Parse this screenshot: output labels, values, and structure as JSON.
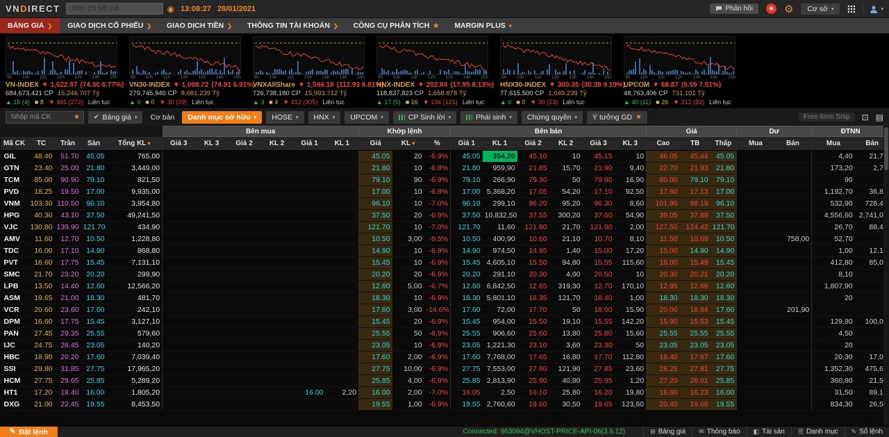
{
  "topbar": {
    "logo_vn": "VN",
    "logo_d": "D",
    "logo_rest": "IRECT",
    "search_placeholder": "Xem chi tiết mã",
    "time": "13:08:27",
    "date": "28/01/2021",
    "feedback": "Phản hồi",
    "market": "Cơ sở"
  },
  "menu": {
    "items": [
      {
        "label": "BẢNG GIÁ",
        "suffix": "arrow",
        "active": true
      },
      {
        "label": "GIAO DỊCH CỔ PHIẾU",
        "suffix": "arrow",
        "active": false
      },
      {
        "label": "GIAO DỊCH TIỀN",
        "suffix": "arrow",
        "active": false
      },
      {
        "label": "THÔNG TIN TÀI KHOÁN",
        "suffix": "arrow",
        "active": false
      },
      {
        "label": "CÔNG CỤ PHÂN TÍCH",
        "suffix": "star",
        "active": false
      },
      {
        "label": "MARGIN PLUS",
        "suffix": "caret",
        "active": false
      }
    ]
  },
  "indices": [
    {
      "name": "VN-INDEX",
      "direction": "down",
      "value": "1,022.87",
      "change": "(74.30 6.77%)",
      "volume": "684,673,421 CP",
      "turnover": "15,246.707 Tỷ",
      "up": "15 (4)",
      "flat": "8",
      "down": "481 (272)",
      "session": "Liên tục"
    },
    {
      "name": "VN30-INDEX",
      "direction": "down",
      "value": "1,008.72",
      "change": "(74.91 6.91%)",
      "volume": "279,745,940 CP",
      "turnover": "8,681.239 Tỷ",
      "up": "0",
      "flat": "0",
      "down": "30 (29)",
      "session": "Liên tục"
    },
    {
      "name": "VNXAllShare",
      "direction": "down",
      "value": "1,546.18",
      "change": "(112.93 6.81%)",
      "volume": "726,738,180 CP",
      "turnover": "15,993.712 Tỷ",
      "up": "3",
      "flat": "4",
      "down": "412 (305)",
      "session": "Liên tục"
    },
    {
      "name": "HNX-INDEX",
      "direction": "down",
      "value": "202.84",
      "change": "(17.95 8.13%)",
      "volume": "118,837,823 CP",
      "turnover": "1,658.878 Tỷ",
      "up": "17 (5)",
      "flat": "16",
      "down": "194 (121)",
      "session": "Liên tục"
    },
    {
      "name": "HNX30-INDEX",
      "direction": "down",
      "value": "300.35",
      "change": "(30.38 9.19%)",
      "volume": "77,615,500 CP",
      "turnover": "1,049.239 Tỷ",
      "up": "0",
      "flat": "0",
      "down": "30 (23)",
      "session": "Liên tục"
    },
    {
      "name": "UPCOM",
      "direction": "down",
      "value": "68.87",
      "change": "(5.59 7.51%)",
      "volume": "48,763,406 CP",
      "turnover": "731.101 Tỷ",
      "up": "40 (11)",
      "flat": "26",
      "down": "212 (82)",
      "session": "Liên tục"
    }
  ],
  "chart_axis": [
    "9h",
    "10h",
    "11h",
    "12h",
    "13h",
    "14h",
    "15h"
  ],
  "filterbar": {
    "symbol_placeholder": "Nhập mã CK",
    "board_select": "Bảng giá",
    "view_label": "Cơ bản",
    "active_tab": "Danh mục sở hữu",
    "tabs": [
      "HOSE",
      "HNX",
      "UPCOM",
      "CP Sinh lời",
      "Phái sinh",
      "Chứng quyền",
      "Ý tưởng GD"
    ],
    "ghost_text": "Free-form Snip"
  },
  "table": {
    "groups": {
      "buy": "Bên mua",
      "match": "Khớp lệnh",
      "sell": "Bên bán",
      "price": "Giá",
      "du": "Dư",
      "foreign": "ĐTNN"
    },
    "columns": [
      "Mã CK",
      "TC",
      "Trần",
      "Sàn",
      "Tổng KL",
      "Giá 3",
      "KL 3",
      "Giá 2",
      "KL 2",
      "Giá 1",
      "KL 1",
      "Giá",
      "KL",
      "%",
      "Giá 1",
      "KL 1",
      "Giá 2",
      "KL 2",
      "Giá 3",
      "KL 3",
      "Cao",
      "TB",
      "Thấp",
      "Mua",
      "Bán",
      "Mua",
      "Bán"
    ],
    "rows": [
      {
        "code": "GIL",
        "tc": "48.40",
        "ceil": "51.70",
        "floor": "45.05",
        "total": "765,00",
        "buy": [
          "",
          "",
          "",
          "",
          "",
          ""
        ],
        "match": [
          "45.05",
          "20",
          "-6.9%"
        ],
        "sell": [
          "45.05",
          "354,20",
          "45.10",
          "10",
          "45.15",
          "10"
        ],
        "hi": "46.05",
        "avg": "45.44",
        "lo": "45.05",
        "du": [
          "",
          ""
        ],
        "fr": [
          "4,40",
          "21,70"
        ],
        "flash": "sk1"
      },
      {
        "code": "GTN",
        "tc": "23.40",
        "ceil": "25.00",
        "floor": "21.80",
        "total": "3,449,00",
        "buy": [
          "",
          "",
          "",
          "",
          "",
          ""
        ],
        "match": [
          "21.80",
          "10",
          "-6.8%"
        ],
        "sell": [
          "21.80",
          "959,90",
          "21.85",
          "15,70",
          "21.90",
          "9,40"
        ],
        "hi": "22.70",
        "avg": "21.93",
        "lo": "21.80",
        "du": [
          "",
          ""
        ],
        "fr": [
          "173,20",
          "2,70"
        ],
        "flash": ""
      },
      {
        "code": "TCM",
        "tc": "85.00",
        "ceil": "90.90",
        "floor": "79.10",
        "total": "821,50",
        "buy": [
          "",
          "",
          "",
          "",
          "",
          ""
        ],
        "match": [
          "79.10",
          "90",
          "-6.9%"
        ],
        "sell": [
          "79.10",
          "266,90",
          "79.30",
          "50",
          "79.90",
          "16,90"
        ],
        "hi": "80.00",
        "avg": "79.10",
        "lo": "79.10",
        "du": [
          "",
          ""
        ],
        "fr": [
          "90",
          ""
        ],
        "flash": ""
      },
      {
        "code": "PVD",
        "tc": "18.25",
        "ceil": "19.50",
        "floor": "17.00",
        "total": "9,935,00",
        "buy": [
          "",
          "",
          "",
          "",
          "",
          ""
        ],
        "match": [
          "17.00",
          "10",
          "-6.8%"
        ],
        "sell": [
          "17.00",
          "5,368,20",
          "17.05",
          "54,20",
          "17.10",
          "92,50"
        ],
        "hi": "17.60",
        "avg": "17.13",
        "lo": "17.00",
        "du": [
          "",
          ""
        ],
        "fr": [
          "1,192,70",
          "36,80"
        ],
        "flash": ""
      },
      {
        "code": "VNM",
        "tc": "103.30",
        "ceil": "110.50",
        "floor": "96.10",
        "total": "3,954,80",
        "buy": [
          "",
          "",
          "",
          "",
          "",
          ""
        ],
        "match": [
          "96.10",
          "10",
          "-7.0%"
        ],
        "sell": [
          "96.10",
          "299,10",
          "96.20",
          "95,20",
          "96.30",
          "8,60"
        ],
        "hi": "101.90",
        "avg": "98.19",
        "lo": "96.10",
        "du": [
          "",
          ""
        ],
        "fr": [
          "532,90",
          "728,40"
        ],
        "flash": ""
      },
      {
        "code": "HPG",
        "tc": "40.30",
        "ceil": "43.10",
        "floor": "37.50",
        "total": "49,241,50",
        "buy": [
          "",
          "",
          "",
          "",
          "",
          ""
        ],
        "match": [
          "37.50",
          "20",
          "-6.9%"
        ],
        "sell": [
          "37.50",
          "10,832,50",
          "37.55",
          "300,20",
          "37.60",
          "54,90"
        ],
        "hi": "39.05",
        "avg": "37.89",
        "lo": "37.50",
        "du": [
          "",
          ""
        ],
        "fr": [
          "4,556,60",
          "2,741,00"
        ],
        "flash": ""
      },
      {
        "code": "VJC",
        "tc": "130.80",
        "ceil": "139.90",
        "floor": "121.70",
        "total": "434,90",
        "buy": [
          "",
          "",
          "",
          "",
          "",
          ""
        ],
        "match": [
          "121.70",
          "10",
          "-7.0%"
        ],
        "sell": [
          "121.70",
          "11,60",
          "121.80",
          "21,70",
          "121.90",
          "2,00"
        ],
        "hi": "127.50",
        "avg": "124.42",
        "lo": "121.70",
        "du": [
          "",
          ""
        ],
        "fr": [
          "26,70",
          "88,40"
        ],
        "flash": ""
      },
      {
        "code": "AMV",
        "tc": "11.60",
        "ceil": "12.70",
        "floor": "10.50",
        "total": "1,228,80",
        "buy": [
          "",
          "",
          "",
          "",
          "",
          ""
        ],
        "match": [
          "10.50",
          "3,00",
          "-9.5%"
        ],
        "sell": [
          "10.50",
          "400,90",
          "10.60",
          "21,10",
          "10.70",
          "8,10"
        ],
        "hi": "11.50",
        "avg": "10.69",
        "lo": "10.50",
        "du": [
          "",
          "758,00"
        ],
        "fr": [
          "52,70",
          ""
        ],
        "flash": ""
      },
      {
        "code": "TDC",
        "tc": "16.00",
        "ceil": "17.10",
        "floor": "14.90",
        "total": "868,80",
        "buy": [
          "",
          "",
          "",
          "",
          "",
          ""
        ],
        "match": [
          "14.90",
          "10",
          "-6.9%"
        ],
        "sell": [
          "14.90",
          "974,50",
          "14.95",
          "1,40",
          "15.00",
          "17,20"
        ],
        "hi": "15.00",
        "avg": "14.90",
        "lo": "14.90",
        "du": [
          "",
          ""
        ],
        "fr": [
          "1,00",
          "12,10"
        ],
        "flash": ""
      },
      {
        "code": "PVT",
        "tc": "16.60",
        "ceil": "17.75",
        "floor": "15.45",
        "total": "7,131,10",
        "buy": [
          "",
          "",
          "",
          "",
          "",
          ""
        ],
        "match": [
          "15.45",
          "10",
          "-6.9%"
        ],
        "sell": [
          "15.45",
          "4,605,10",
          "15.50",
          "94,80",
          "15.55",
          "115,60"
        ],
        "hi": "16.00",
        "avg": "15.49",
        "lo": "15.45",
        "du": [
          "",
          ""
        ],
        "fr": [
          "412,80",
          "85,00"
        ],
        "flash": ""
      },
      {
        "code": "SMC",
        "tc": "21.70",
        "ceil": "23.20",
        "floor": "20.20",
        "total": "299,90",
        "buy": [
          "",
          "",
          "",
          "",
          "",
          ""
        ],
        "match": [
          "20.20",
          "20",
          "-6.9%"
        ],
        "sell": [
          "20.20",
          "291,10",
          "20.30",
          "4,00",
          "20.50",
          "10"
        ],
        "hi": "20.30",
        "avg": "20.21",
        "lo": "20.20",
        "du": [
          "",
          ""
        ],
        "fr": [
          "8,10",
          ""
        ],
        "flash": ""
      },
      {
        "code": "LPB",
        "tc": "13.50",
        "ceil": "14.40",
        "floor": "12.60",
        "total": "12,566,20",
        "buy": [
          "",
          "",
          "",
          "",
          "",
          ""
        ],
        "match": [
          "12.60",
          "5,00",
          "-6.7%"
        ],
        "sell": [
          "12.60",
          "6,842,50",
          "12.65",
          "319,30",
          "12.70",
          "170,10"
        ],
        "hi": "12.95",
        "avg": "12.66",
        "lo": "12.60",
        "du": [
          "",
          ""
        ],
        "fr": [
          "1,807,90",
          ""
        ],
        "flash": ""
      },
      {
        "code": "ASM",
        "tc": "19.65",
        "ceil": "21.00",
        "floor": "18.30",
        "total": "481,70",
        "buy": [
          "",
          "",
          "",
          "",
          "",
          ""
        ],
        "match": [
          "18.30",
          "10",
          "-6.9%"
        ],
        "sell": [
          "18.30",
          "5,801,10",
          "18.35",
          "121,70",
          "18.40",
          "1,00"
        ],
        "hi": "18.30",
        "avg": "18.30",
        "lo": "18.30",
        "du": [
          "",
          ""
        ],
        "fr": [
          "20",
          ""
        ],
        "flash": ""
      },
      {
        "code": "VCR",
        "tc": "20.60",
        "ceil": "23.60",
        "floor": "17.60",
        "total": "242,10",
        "buy": [
          "",
          "",
          "",
          "",
          "",
          ""
        ],
        "match": [
          "17.60",
          "3,00",
          "-14.6%"
        ],
        "sell": [
          "17.60",
          "72,00",
          "17.70",
          "50",
          "18.00",
          "15,90"
        ],
        "hi": "20.00",
        "avg": "18.94",
        "lo": "17.60",
        "du": [
          "",
          "201,90"
        ],
        "fr": [
          "",
          ""
        ],
        "flash": ""
      },
      {
        "code": "DPM",
        "tc": "16.60",
        "ceil": "17.75",
        "floor": "15.45",
        "total": "3,127,10",
        "buy": [
          "",
          "",
          "",
          "",
          "",
          ""
        ],
        "match": [
          "15.45",
          "20",
          "-6.9%"
        ],
        "sell": [
          "15.45",
          "954,00",
          "15.50",
          "19,10",
          "15.55",
          "142,20"
        ],
        "hi": "15.90",
        "avg": "15.53",
        "lo": "15.45",
        "du": [
          "",
          ""
        ],
        "fr": [
          "129,80",
          "100,00"
        ],
        "flash": ""
      },
      {
        "code": "PAN",
        "tc": "27.45",
        "ceil": "29.35",
        "floor": "25.55",
        "total": "579,60",
        "buy": [
          "",
          "",
          "",
          "",
          "",
          ""
        ],
        "match": [
          "25.55",
          "50",
          "-6.9%"
        ],
        "sell": [
          "25.55",
          "906,60",
          "25.60",
          "13,80",
          "25.80",
          "15,60"
        ],
        "hi": "25.55",
        "avg": "25.55",
        "lo": "25.55",
        "du": [
          "",
          ""
        ],
        "fr": [
          "4,50",
          ""
        ],
        "flash": ""
      },
      {
        "code": "IJC",
        "tc": "24.75",
        "ceil": "26.45",
        "floor": "23.05",
        "total": "140,20",
        "buy": [
          "",
          "",
          "",
          "",
          "",
          ""
        ],
        "match": [
          "23.05",
          "10",
          "-6.9%"
        ],
        "sell": [
          "23.05",
          "1,221,30",
          "23.10",
          "3,60",
          "23.30",
          "50"
        ],
        "hi": "23.05",
        "avg": "23.05",
        "lo": "23.05",
        "du": [
          "",
          ""
        ],
        "fr": [
          "20",
          ""
        ],
        "flash": ""
      },
      {
        "code": "HBC",
        "tc": "18.90",
        "ceil": "20.20",
        "floor": "17.60",
        "total": "7,039,40",
        "buy": [
          "",
          "",
          "",
          "",
          "",
          ""
        ],
        "match": [
          "17.60",
          "2,00",
          "-6.9%"
        ],
        "sell": [
          "17.60",
          "7,768,00",
          "17.65",
          "16,80",
          "17.70",
          "112,80"
        ],
        "hi": "18.40",
        "avg": "17.67",
        "lo": "17.60",
        "du": [
          "",
          ""
        ],
        "fr": [
          "20,30",
          "17,00"
        ],
        "flash": ""
      },
      {
        "code": "SSI",
        "tc": "29.80",
        "ceil": "31.85",
        "floor": "27.75",
        "total": "17,965,20",
        "buy": [
          "",
          "",
          "",
          "",
          "",
          ""
        ],
        "match": [
          "27.75",
          "10,00",
          "-6.9%"
        ],
        "sell": [
          "27.75",
          "7,553,00",
          "27.80",
          "121,90",
          "27.85",
          "23,60"
        ],
        "hi": "28.25",
        "avg": "27.81",
        "lo": "27.75",
        "du": [
          "",
          ""
        ],
        "fr": [
          "1,352,30",
          "475,60"
        ],
        "flash": ""
      },
      {
        "code": "HCM",
        "tc": "27.75",
        "ceil": "29.65",
        "floor": "25.85",
        "total": "5,289,20",
        "buy": [
          "",
          "",
          "",
          "",
          "",
          ""
        ],
        "match": [
          "25.85",
          "4,00",
          "-6.9%"
        ],
        "sell": [
          "25.85",
          "2,813,90",
          "25.90",
          "40,80",
          "25.95",
          "1,20"
        ],
        "hi": "27.20",
        "avg": "26.01",
        "lo": "25.85",
        "du": [
          "",
          ""
        ],
        "fr": [
          "360,80",
          "21,50"
        ],
        "flash": ""
      },
      {
        "code": "HT1",
        "tc": "17.20",
        "ceil": "18.40",
        "floor": "16.00",
        "total": "1,805,20",
        "buy": [
          "",
          "",
          "",
          "",
          "16.00",
          "2,20"
        ],
        "match": [
          "16.00",
          "2,00",
          "-7.0%"
        ],
        "sell": [
          "16.05",
          "2,50",
          "16.10",
          "25,80",
          "16.20",
          "19,80"
        ],
        "hi": "16.60",
        "avg": "16.23",
        "lo": "16.00",
        "du": [
          "",
          ""
        ],
        "fr": [
          "31,50",
          "89,10"
        ],
        "flash": ""
      },
      {
        "code": "DXG",
        "tc": "21.00",
        "ceil": "22.45",
        "floor": "19.55",
        "total": "8,453,50",
        "buy": [
          "",
          "",
          "",
          "",
          "",
          ""
        ],
        "match": [
          "19.55",
          "1,00",
          "-6.9%"
        ],
        "sell": [
          "19.55",
          "2,760,60",
          "19.60",
          "30,50",
          "19.65",
          "123,60"
        ],
        "hi": "20.40",
        "avg": "19.66",
        "lo": "19.55",
        "du": [
          "",
          ""
        ],
        "fr": [
          "834,30",
          "26,50"
        ],
        "flash": ""
      }
    ]
  },
  "bottombar": {
    "order_button": "Đặt lệnh",
    "connection": "Connected: 963094@VHOST-PRICE-API-06(3.9.12)",
    "links": [
      "Bảng giá",
      "Thông báo",
      "Tài sản",
      "Danh mục",
      "Sổ lệnh"
    ]
  }
}
